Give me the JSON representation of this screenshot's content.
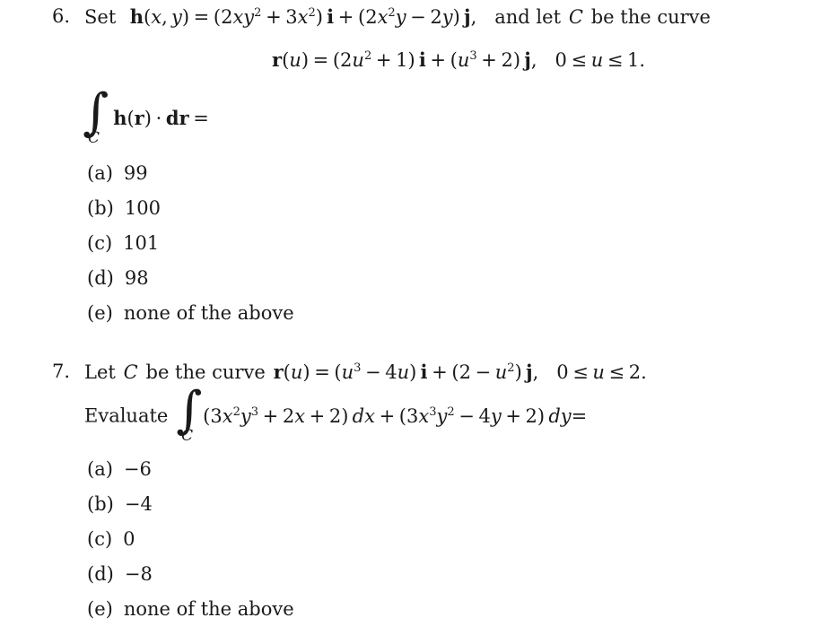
{
  "document": {
    "type": "calculus-exam-multiple-choice",
    "background_color": "#ffffff",
    "text_color": "#1a1a1a"
  },
  "questions": [
    {
      "number": "6.",
      "stem_prefix": "Set",
      "field_name": "h",
      "field_args": "(x, y)",
      "field_definition": "(2xy² + 3x²) i + (2x²y − 2y) j,",
      "stem_suffix": "and let",
      "curve_symbol": "C",
      "stem_tail": "be the curve",
      "parametrization": "r(u) = (2u² + 1) i + (u³ + 2) j,   0 ≤ u ≤ 1.",
      "integral_label": "∫",
      "integral_subscript": "C",
      "integrand": "h(r) · dr =",
      "options": [
        {
          "label": "(a)",
          "value": "99"
        },
        {
          "label": "(b)",
          "value": "100"
        },
        {
          "label": "(c)",
          "value": "101"
        },
        {
          "label": "(d)",
          "value": "98"
        },
        {
          "label": "(e)",
          "value": "none of the above"
        }
      ]
    },
    {
      "number": "7.",
      "stem_prefix": "Let",
      "curve_symbol": "C",
      "stem_tail": "be the curve",
      "parametrization": "r(u) = (u³ − 4u) i + (2 − u²) j,   0 ≤ u ≤ 2.",
      "evaluate_label": "Evaluate",
      "integral_label": "∫",
      "integral_subscript": "C",
      "integrand_dx": "(3x²y³ + 2x + 2) dx",
      "integrand_dy": "+ (3x³y² − 4y + 2) dy=",
      "options": [
        {
          "label": "(a)",
          "value": "−6"
        },
        {
          "label": "(b)",
          "value": "−4"
        },
        {
          "label": "(c)",
          "value": "0"
        },
        {
          "label": "(d)",
          "value": "−8"
        },
        {
          "label": "(e)",
          "value": "none of the above"
        }
      ]
    }
  ]
}
